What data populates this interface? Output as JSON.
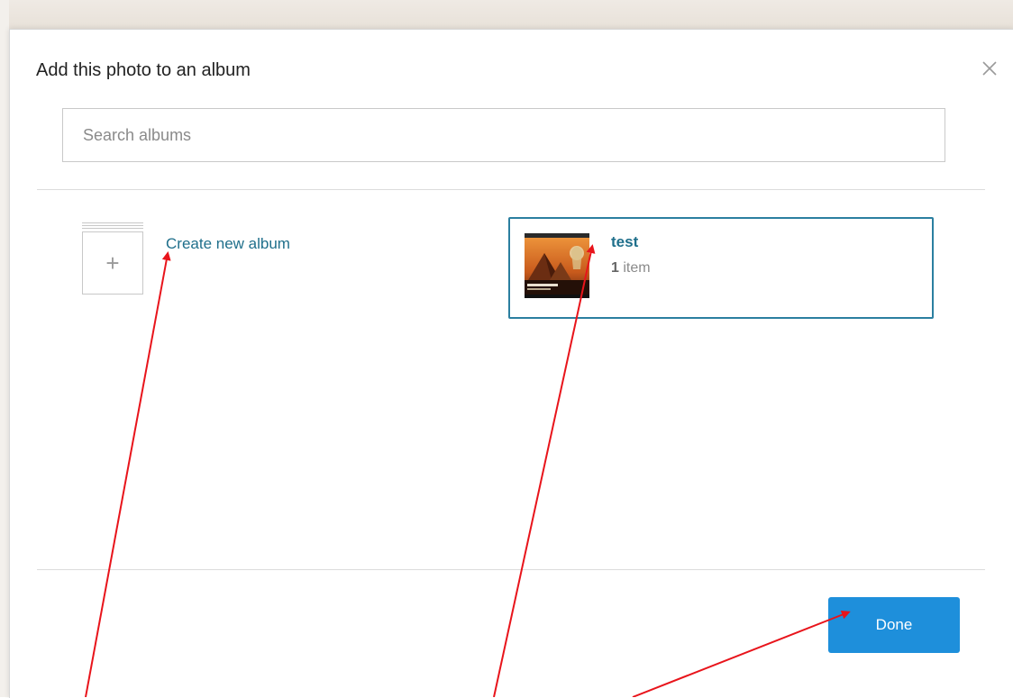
{
  "dialog": {
    "title": "Add this photo to an album",
    "close_icon": "close-icon"
  },
  "search": {
    "placeholder": "Search albums",
    "value": ""
  },
  "create_album": {
    "label": "Create new album",
    "icon": "plus-icon"
  },
  "albums": [
    {
      "name": "test",
      "count_number": "1",
      "count_unit": "item",
      "selected": true
    }
  ],
  "footer": {
    "done_label": "Done"
  },
  "colors": {
    "accent": "#1e8fdb",
    "link": "#1f6f8b",
    "selected_border": "#2b7fa0",
    "annotation_arrow": "#e8141b"
  }
}
